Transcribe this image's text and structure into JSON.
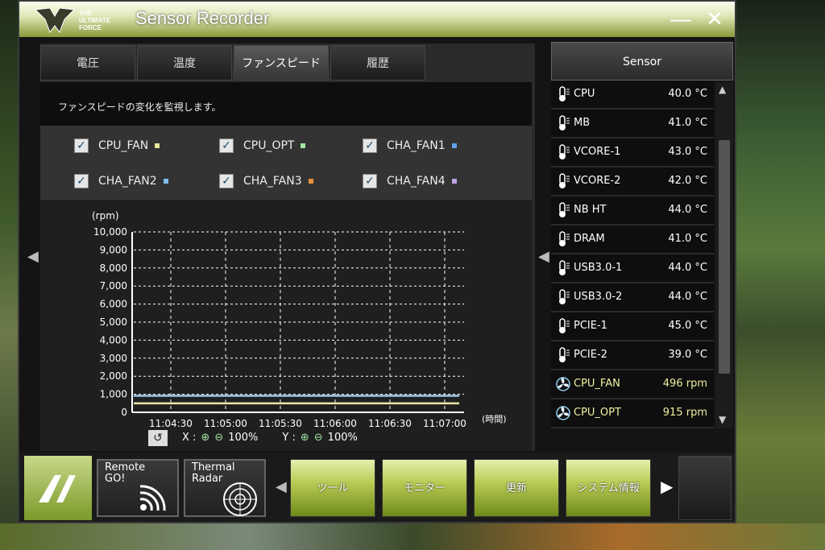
{
  "window": {
    "title": "Sensor Recorder",
    "logo_text": "THE ULTIMATE FORCE",
    "minimize": "—",
    "close": "✕"
  },
  "tabs": [
    {
      "label": "電圧"
    },
    {
      "label": "温度"
    },
    {
      "label": "ファンスピード",
      "active": true
    },
    {
      "label": "履歴"
    }
  ],
  "description": "ファンスピードの変化を監視します。",
  "fans": [
    {
      "label": "CPU_FAN",
      "checked": true,
      "color": "#e8e8a0"
    },
    {
      "label": "CPU_OPT",
      "checked": true,
      "color": "#a0e8a0"
    },
    {
      "label": "CHA_FAN1",
      "checked": true,
      "color": "#60a0e8"
    },
    {
      "label": "CHA_FAN2",
      "checked": true,
      "color": "#80c0f0"
    },
    {
      "label": "CHA_FAN3",
      "checked": true,
      "color": "#e89040"
    },
    {
      "label": "CHA_FAN4",
      "checked": true,
      "color": "#c0a0e8"
    }
  ],
  "chart_data": {
    "type": "line",
    "ylabel": "(rpm)",
    "xlabel": "(時間)",
    "ylim": [
      0,
      10000
    ],
    "yticks": [
      "0",
      "1,000",
      "2,000",
      "3,000",
      "4,000",
      "5,000",
      "6,000",
      "7,000",
      "8,000",
      "9,000",
      "10,000"
    ],
    "x": [
      "11:04:30",
      "11:05:00",
      "11:05:30",
      "11:06:00",
      "11:06:30",
      "11:07:00"
    ],
    "series": [
      {
        "name": "CPU_FAN",
        "color": "#e8e8a0",
        "values": [
          496,
          496,
          496,
          496,
          496,
          496
        ]
      },
      {
        "name": "CPU_OPT",
        "color": "#a0c8e8",
        "values": [
          915,
          915,
          915,
          915,
          915,
          915
        ]
      }
    ],
    "grid": true
  },
  "zoom": {
    "reset": "↺",
    "x_label": "X :",
    "x_value": "100%",
    "y_label": "Y :",
    "y_value": "100%"
  },
  "sensor": {
    "header": "Sensor",
    "items": [
      {
        "name": "CPU",
        "value": "40.0 °C",
        "kind": "temp"
      },
      {
        "name": "MB",
        "value": "41.0 °C",
        "kind": "temp"
      },
      {
        "name": "VCORE-1",
        "value": "43.0 °C",
        "kind": "temp"
      },
      {
        "name": "VCORE-2",
        "value": "42.0 °C",
        "kind": "temp"
      },
      {
        "name": "NB HT",
        "value": "44.0 °C",
        "kind": "temp"
      },
      {
        "name": "DRAM",
        "value": "41.0 °C",
        "kind": "temp"
      },
      {
        "name": "USB3.0-1",
        "value": "44.0 °C",
        "kind": "temp"
      },
      {
        "name": "USB3.0-2",
        "value": "44.0 °C",
        "kind": "temp"
      },
      {
        "name": "PCIE-1",
        "value": "45.0 °C",
        "kind": "temp"
      },
      {
        "name": "PCIE-2",
        "value": "39.0 °C",
        "kind": "temp"
      },
      {
        "name": "CPU_FAN",
        "value": "496  rpm",
        "kind": "fan"
      },
      {
        "name": "CPU_OPT",
        "value": "915  rpm",
        "kind": "fan"
      }
    ]
  },
  "bottom": {
    "remote_go": "Remote\nGO!",
    "thermal_radar": "Thermal\nRadar",
    "menu": [
      "ツール",
      "モニター",
      "更新",
      "システム情報"
    ]
  }
}
